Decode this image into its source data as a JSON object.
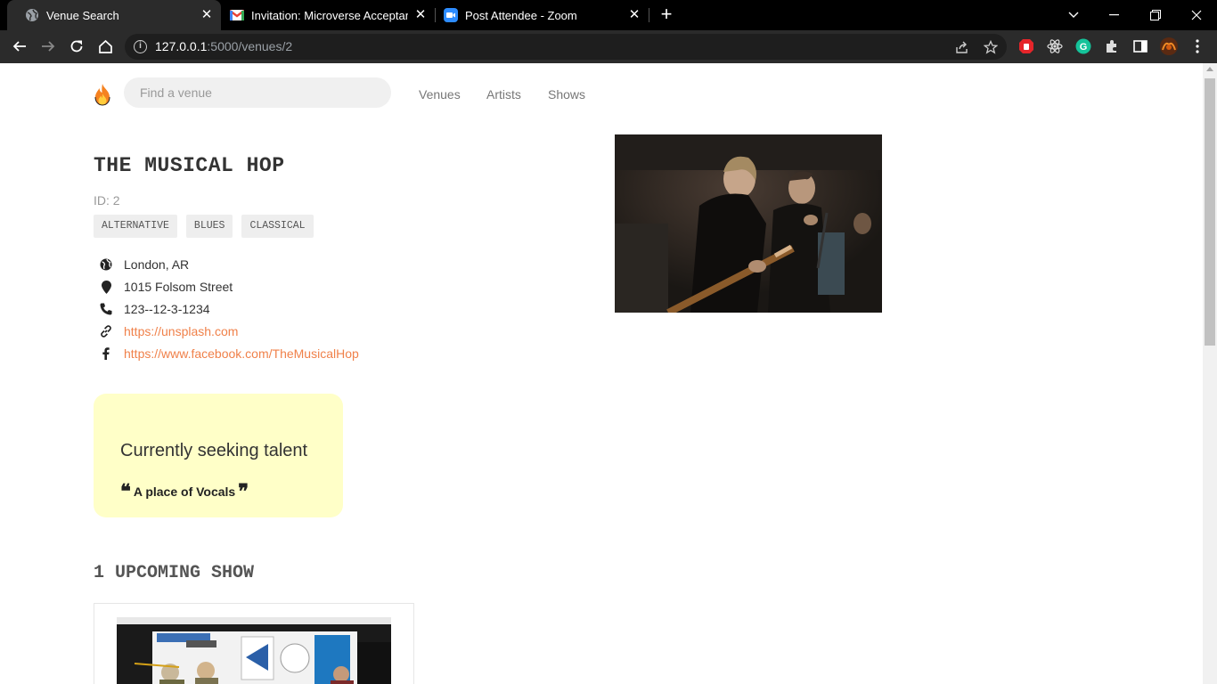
{
  "browser": {
    "tabs": [
      {
        "title": "Venue Search",
        "icon": "globe-icon"
      },
      {
        "title": "Invitation: Microverse Acceptance",
        "icon": "gmail-icon"
      },
      {
        "title": "Post Attendee - Zoom",
        "icon": "zoom-icon"
      }
    ],
    "url_host": "127.0.0.1",
    "url_path": ":5000/venues/2"
  },
  "nav": {
    "search_placeholder": "Find a venue",
    "links": [
      "Venues",
      "Artists",
      "Shows"
    ]
  },
  "venue": {
    "name": "THE MUSICAL HOP",
    "id_label": "ID: 2",
    "genres": [
      "ALTERNATIVE",
      "BLUES",
      "CLASSICAL"
    ],
    "city_state": "London, AR",
    "address": "1015 Folsom Street",
    "phone": "123--12-3-1234",
    "website": "https://unsplash.com",
    "facebook": "https://www.facebook.com/TheMusicalHop"
  },
  "seeking": {
    "heading": "Currently seeking talent",
    "description": "A place of Vocals"
  },
  "shows": {
    "upcoming_heading": "1 UPCOMING SHOW"
  },
  "colors": {
    "link": "#f0814a",
    "seeking_bg": "#ffffc8"
  }
}
